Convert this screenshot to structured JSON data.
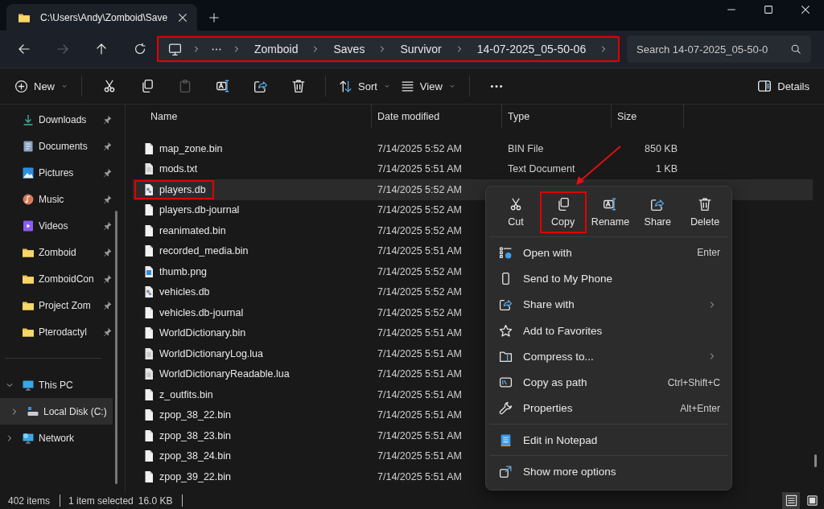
{
  "window": {
    "tab_title": "C:\\Users\\Andy\\Zomboid\\Save"
  },
  "nav": {
    "buttons": [
      {
        "kind": "back",
        "disabled": false
      },
      {
        "kind": "forward",
        "disabled": true
      },
      {
        "kind": "up",
        "disabled": false
      },
      {
        "kind": "refresh",
        "disabled": false
      }
    ],
    "breadcrumb": [
      "Zomboid",
      "Saves",
      "Survivor",
      "14-07-2025_05-50-06"
    ],
    "breadcrumb_highlighted": true,
    "search": {
      "placeholder": "Search 14-07-2025_05-50-0"
    }
  },
  "toolbar": {
    "new": {
      "label": "New"
    },
    "actions": [
      {
        "kind": "cut",
        "disabled": false
      },
      {
        "kind": "copy",
        "disabled": false
      },
      {
        "kind": "paste",
        "disabled": true
      },
      {
        "kind": "rename",
        "disabled": false
      },
      {
        "kind": "share",
        "disabled": false
      },
      {
        "kind": "delete",
        "disabled": false
      }
    ],
    "sort": {
      "label": "Sort"
    },
    "view": {
      "label": "View"
    },
    "details": {
      "label": "Details"
    }
  },
  "sidebar": {
    "quick_access": [
      {
        "kind": "download",
        "label": "Downloads",
        "pinned": true
      },
      {
        "kind": "documents",
        "label": "Documents",
        "pinned": true
      },
      {
        "kind": "pictures",
        "label": "Pictures",
        "pinned": true
      },
      {
        "kind": "music",
        "label": "Music",
        "pinned": true
      },
      {
        "kind": "videos",
        "label": "Videos",
        "pinned": true
      },
      {
        "kind": "folder",
        "label": "Zomboid",
        "pinned": true
      },
      {
        "kind": "folder",
        "label": "ZomboidCon",
        "pinned": true
      },
      {
        "kind": "folder",
        "label": "Project Zom",
        "pinned": true
      },
      {
        "kind": "folder",
        "label": "Pterodactyl",
        "pinned": true
      }
    ],
    "tree": [
      {
        "kind": "pc",
        "label": "This PC",
        "expanded": true,
        "selected": false,
        "children": [
          {
            "kind": "drive",
            "label": "Local Disk (C:)",
            "expanded": false,
            "selected": true
          }
        ]
      },
      {
        "kind": "network",
        "label": "Network",
        "expanded": false,
        "selected": false
      }
    ]
  },
  "table": {
    "columns": [
      "Name",
      "Date modified",
      "Type",
      "Size"
    ],
    "rows": [
      {
        "kind": "blank",
        "name": "map_zone.bin",
        "date": "7/14/2025 5:52 AM",
        "type": "BIN File",
        "size": "850 KB",
        "selected": false
      },
      {
        "kind": "text",
        "name": "mods.txt",
        "date": "7/14/2025 5:51 AM",
        "type": "Text Document",
        "size": "1 KB",
        "selected": false
      },
      {
        "kind": "db",
        "name": "players.db",
        "date": "7/14/2025 5:52 AM",
        "selected": true,
        "highlighted": true
      },
      {
        "kind": "blank",
        "name": "players.db-journal",
        "date": "7/14/2025 5:52 AM",
        "selected": false
      },
      {
        "kind": "blank",
        "name": "reanimated.bin",
        "date": "7/14/2025 5:52 AM",
        "selected": false
      },
      {
        "kind": "blank",
        "name": "recorded_media.bin",
        "date": "7/14/2025 5:51 AM",
        "selected": false
      },
      {
        "kind": "image",
        "name": "thumb.png",
        "date": "7/14/2025 5:52 AM",
        "selected": false
      },
      {
        "kind": "db",
        "name": "vehicles.db",
        "date": "7/14/2025 5:52 AM",
        "selected": false
      },
      {
        "kind": "blank",
        "name": "vehicles.db-journal",
        "date": "7/14/2025 5:52 AM",
        "selected": false
      },
      {
        "kind": "blank",
        "name": "WorldDictionary.bin",
        "date": "7/14/2025 5:51 AM",
        "selected": false
      },
      {
        "kind": "text",
        "name": "WorldDictionaryLog.lua",
        "date": "7/14/2025 5:51 AM",
        "selected": false
      },
      {
        "kind": "text",
        "name": "WorldDictionaryReadable.lua",
        "date": "7/14/2025 5:51 AM",
        "selected": false
      },
      {
        "kind": "blank",
        "name": "z_outfits.bin",
        "date": "7/14/2025 5:51 AM",
        "selected": false
      },
      {
        "kind": "blank",
        "name": "zpop_38_22.bin",
        "date": "7/14/2025 5:51 AM",
        "selected": false
      },
      {
        "kind": "blank",
        "name": "zpop_38_23.bin",
        "date": "7/14/2025 5:51 AM",
        "selected": false
      },
      {
        "kind": "blank",
        "name": "zpop_38_24.bin",
        "date": "7/14/2025 5:51 AM",
        "selected": false
      },
      {
        "kind": "blank",
        "name": "zpop_39_22.bin",
        "date": "7/14/2025 5:51 AM",
        "selected": false
      }
    ]
  },
  "context_menu": {
    "actions": [
      {
        "kind": "cut",
        "label": "Cut",
        "highlighted": false
      },
      {
        "kind": "copy",
        "label": "Copy",
        "highlighted": true
      },
      {
        "kind": "rename",
        "label": "Rename",
        "highlighted": false
      },
      {
        "kind": "share",
        "label": "Share",
        "highlighted": false
      },
      {
        "kind": "delete",
        "label": "Delete",
        "highlighted": false
      }
    ],
    "groups": [
      [
        {
          "kind": "openwith",
          "label": "Open with",
          "shortcut": "Enter",
          "submenu": false
        },
        {
          "kind": "phone",
          "label": "Send to My Phone",
          "submenu": false
        },
        {
          "kind": "sharewith",
          "label": "Share with",
          "submenu": true
        },
        {
          "kind": "star",
          "label": "Add to Favorites",
          "submenu": false
        },
        {
          "kind": "compress",
          "label": "Compress to...",
          "submenu": true
        },
        {
          "kind": "path",
          "label": "Copy as path",
          "shortcut": "Ctrl+Shift+C",
          "submenu": false
        },
        {
          "kind": "wrench",
          "label": "Properties",
          "shortcut": "Alt+Enter",
          "submenu": false
        }
      ],
      [
        {
          "kind": "notepad",
          "label": "Edit in Notepad",
          "submenu": false
        }
      ],
      [
        {
          "kind": "showmore",
          "label": "Show more options",
          "submenu": false
        }
      ]
    ]
  },
  "callout_arrow": true,
  "status_bar": {
    "item_count": "402 items",
    "selection": "1 item selected",
    "size": "16.0 KB",
    "view_modes": [
      {
        "kind": "details",
        "selected": true
      },
      {
        "kind": "tiles",
        "selected": false
      }
    ]
  }
}
